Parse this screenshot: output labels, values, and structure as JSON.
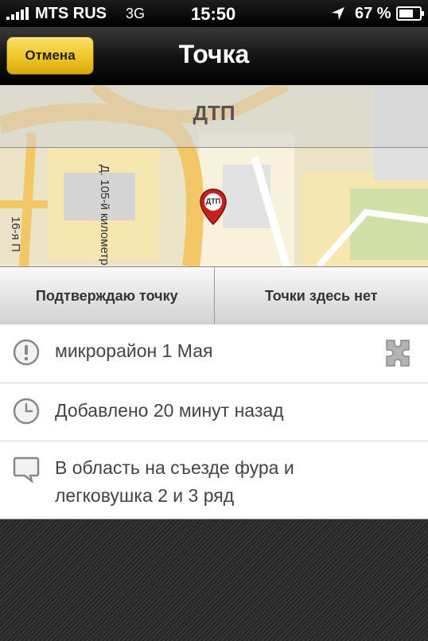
{
  "status_bar": {
    "carrier": "MTS RUS",
    "network": "3G",
    "time": "15:50",
    "battery": "67 %",
    "icons": [
      "signal-icon",
      "location-arrow-icon",
      "battery-icon"
    ]
  },
  "nav": {
    "cancel_label": "Отмена",
    "title": "Точка"
  },
  "map": {
    "title": "ДТП",
    "pin_label": "ДТП",
    "road_label_1": "Д. 105-й километр",
    "road_label_2": "16-я П",
    "colors": {
      "road": "#f3c766",
      "block": "#f6eabb",
      "park": "#cfe1a8"
    }
  },
  "actions": {
    "confirm_label": "Подтверждаю точку",
    "deny_label": "Точки здесь нет"
  },
  "info": {
    "location": "микрорайон 1 Мая",
    "added": "Добавлено 20 минут назад",
    "comment_line1": "В область на съезде фура и",
    "comment_line2": "легковушка 2 и 3 ряд",
    "icons": [
      "exclamation-icon",
      "clock-icon",
      "speech-bubble-icon",
      "puzzle-icon"
    ]
  }
}
